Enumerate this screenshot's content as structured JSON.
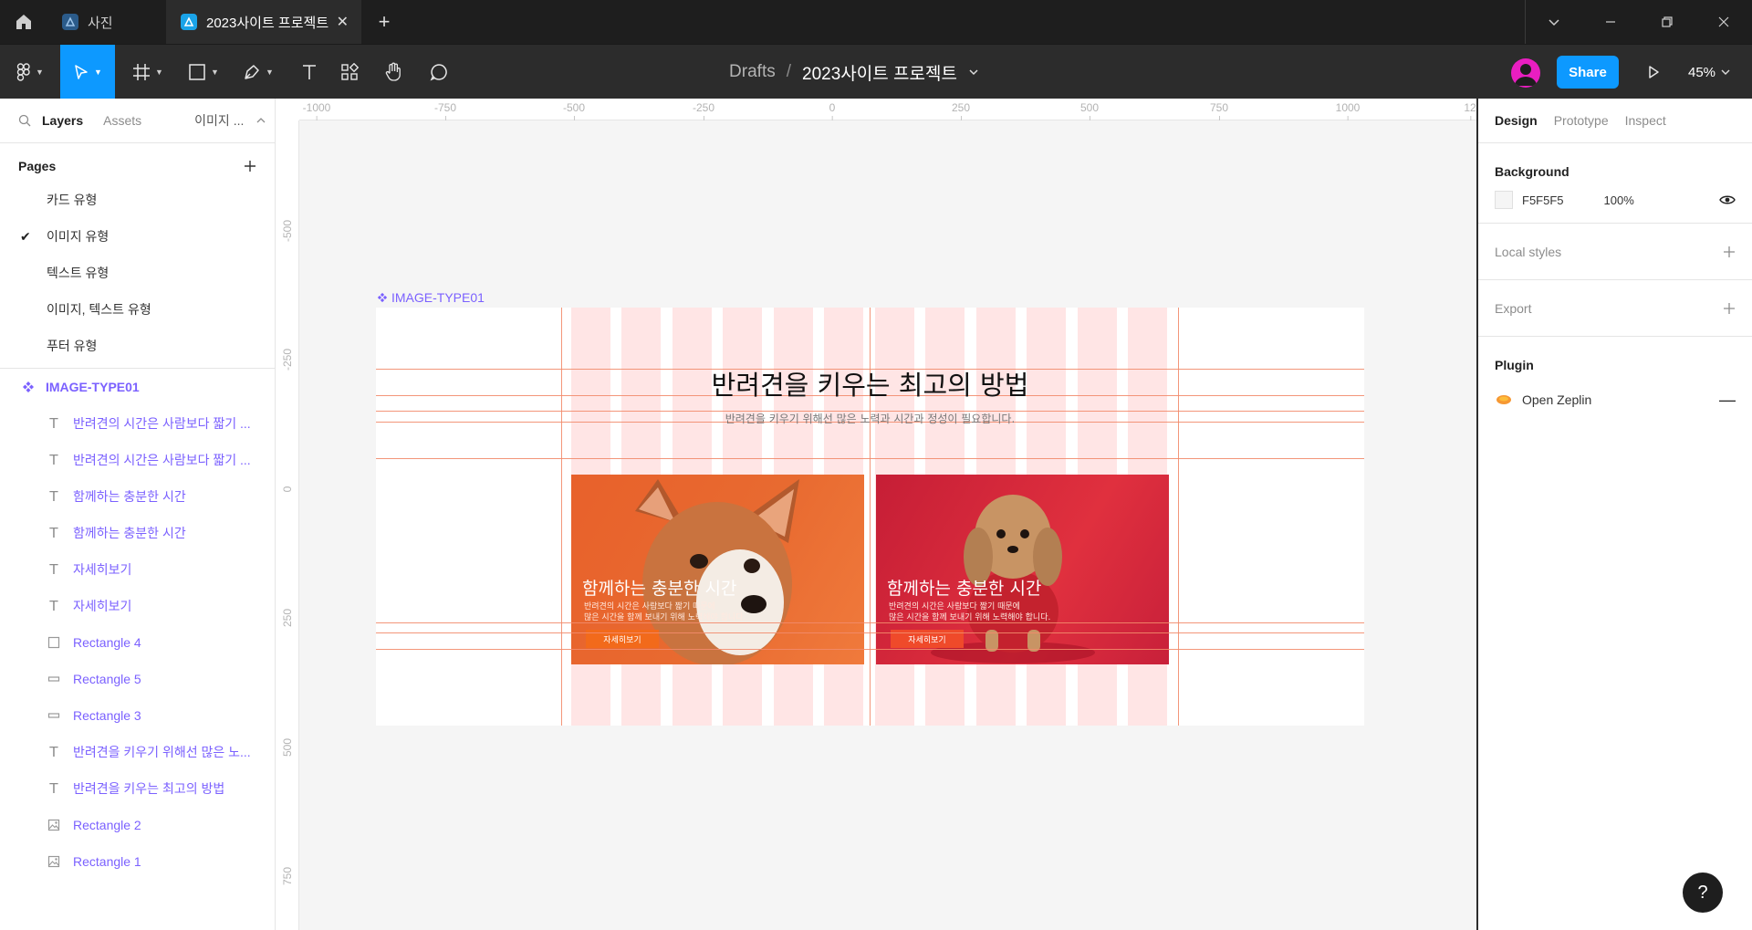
{
  "titlebar": {
    "tabs": [
      {
        "label": "사진",
        "active": false
      },
      {
        "label": "2023사이트 프로젝트",
        "active": true
      }
    ]
  },
  "toolbar": {
    "breadcrumb_root": "Drafts",
    "breadcrumb_sep": "/",
    "file_name": "2023사이트 프로젝트",
    "share_label": "Share",
    "zoom": "45%"
  },
  "left_panel": {
    "tabs": [
      "Layers",
      "Assets"
    ],
    "page_select": "이미지 ...",
    "pages_title": "Pages",
    "pages": [
      {
        "label": "카드 유형",
        "current": false
      },
      {
        "label": "이미지 유형",
        "current": true
      },
      {
        "label": "텍스트 유형",
        "current": false
      },
      {
        "label": "이미지, 텍스트 유형",
        "current": false
      },
      {
        "label": "푸터 유형",
        "current": false
      }
    ],
    "root_layer": "IMAGE-TYPE01",
    "layers": [
      {
        "icon": "text",
        "label": "반려견의 시간은 사람보다 짧기 ..."
      },
      {
        "icon": "text",
        "label": "반려견의 시간은 사람보다 짧기 ..."
      },
      {
        "icon": "text",
        "label": "함께하는 충분한 시간"
      },
      {
        "icon": "text",
        "label": "함께하는 충분한 시간"
      },
      {
        "icon": "text",
        "label": "자세히보기"
      },
      {
        "icon": "text",
        "label": "자세히보기"
      },
      {
        "icon": "rect",
        "label": "Rectangle 4"
      },
      {
        "icon": "rect-thin",
        "label": "Rectangle 5"
      },
      {
        "icon": "rect-thin",
        "label": "Rectangle 3"
      },
      {
        "icon": "text",
        "label": "반려견을 키우기 위해선 많은 노..."
      },
      {
        "icon": "text",
        "label": "반려견을 키우는 최고의 방법"
      },
      {
        "icon": "image",
        "label": "Rectangle 2"
      },
      {
        "icon": "image",
        "label": "Rectangle 1"
      }
    ]
  },
  "canvas": {
    "ruler_top": [
      "-1000",
      "-750",
      "-500",
      "-250",
      "0",
      "250",
      "500",
      "750",
      "1000",
      "12"
    ],
    "ruler_left": [
      "-500",
      "-250",
      "0",
      "250",
      "500",
      "750"
    ],
    "frame_label": "IMAGE-TYPE01",
    "frame": {
      "title": "반려견을 키우는 최고의 방법",
      "subtitle": "반려견을 키우기 위해선 많은 노력과 시간과 정성이 필요합니다.",
      "cards": [
        {
          "title": "함께하는 충분한 시간",
          "text_line1": "반려견의 시간은 사람보다 짧기 때문에",
          "text_line2": "많은 시간을 함께 보내기 위해 노력해야 합니다.",
          "button": "자세히보기",
          "color": "#e8612b"
        },
        {
          "title": "함께하는 충분한 시간",
          "text_line1": "반려견의 시간은 사람보다 짧기 때문에",
          "text_line2": "많은 시간을 함께 보내기 위해 노력해야 합니다.",
          "button": "자세히보기",
          "color": "#d42838"
        }
      ]
    }
  },
  "right_panel": {
    "tabs": [
      "Design",
      "Prototype",
      "Inspect"
    ],
    "background_title": "Background",
    "background_hex": "F5F5F5",
    "background_opacity": "100%",
    "local_styles": "Local styles",
    "export": "Export",
    "plugin_title": "Plugin",
    "plugin_name": "Open Zeplin"
  },
  "help_label": "?",
  "colors": {
    "accent": "#0d99ff",
    "component": "#7b61ff",
    "guide": "#f28b6b"
  }
}
